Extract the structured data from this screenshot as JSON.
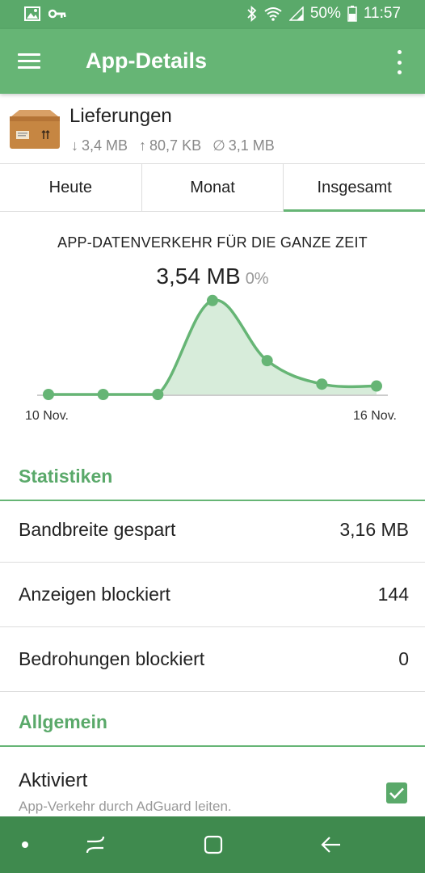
{
  "status_bar": {
    "battery": "50%",
    "time": "11:57",
    "icons": [
      "image-icon",
      "key-icon",
      "bluetooth-icon",
      "wifi-icon",
      "signal-icon",
      "battery-icon"
    ]
  },
  "app_bar": {
    "title": "App-Details",
    "menu_icon": "hamburger-menu-icon",
    "overflow_icon": "more-vert-icon"
  },
  "app": {
    "name": "Lieferungen",
    "icon": "package-icon",
    "download": "3,4 MB",
    "upload": "80,7 KB",
    "saved": "3,1 MB"
  },
  "tabs": [
    {
      "label": "Heute",
      "active": false
    },
    {
      "label": "Monat",
      "active": false
    },
    {
      "label": "Insgesamt",
      "active": true
    }
  ],
  "chart": {
    "title": "APP-DATENVERKEHR FÜR DIE GANZE ZEIT",
    "total": "3,54 MB",
    "percent": "0%",
    "x_start_label": "10 Nov.",
    "x_end_label": "16 Nov."
  },
  "chart_data": {
    "type": "area",
    "x": [
      "10 Nov.",
      "11 Nov.",
      "12 Nov.",
      "13 Nov.",
      "14 Nov.",
      "15 Nov.",
      "16 Nov."
    ],
    "values": [
      0,
      0,
      0,
      1.0,
      0.36,
      0.11,
      0.09
    ],
    "ylim": [
      0,
      1.05
    ],
    "color": "#66b575",
    "fill": "#d7ecda"
  },
  "statistics": {
    "title": "Statistiken",
    "rows": [
      {
        "label": "Bandbreite gespart",
        "value": "3,16 MB"
      },
      {
        "label": "Anzeigen blockiert",
        "value": "144"
      },
      {
        "label": "Bedrohungen blockiert",
        "value": "0"
      }
    ]
  },
  "general": {
    "title": "Allgemein",
    "toggle_title": "Aktiviert",
    "toggle_subtitle": "App-Verkehr durch AdGuard leiten.",
    "checked": true
  },
  "nav_bar": {
    "icons": [
      "dot-icon",
      "recents-icon",
      "home-icon",
      "back-icon"
    ]
  },
  "colors": {
    "status_bar": "#5aa96a",
    "app_bar": "#66b575",
    "accent": "#5aa96a",
    "nav_bar": "#3f8a4e"
  }
}
